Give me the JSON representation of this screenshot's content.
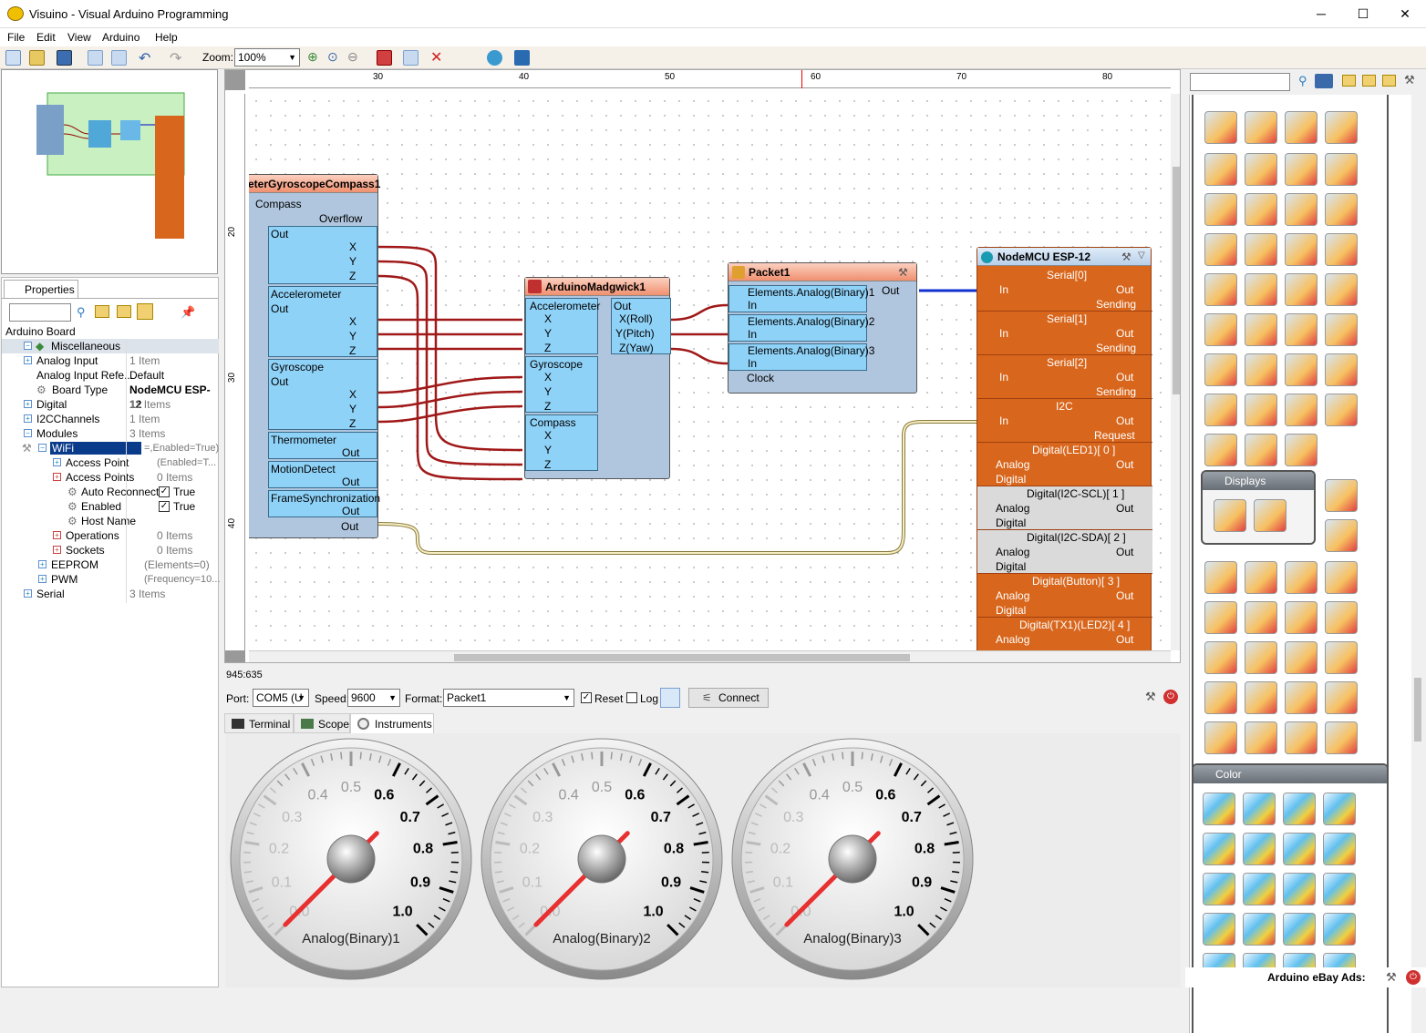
{
  "window": {
    "title": "Visuino - Visual Arduino Programming",
    "controls": {
      "minimize": "─",
      "maximize": "☐",
      "close": "✕"
    }
  },
  "menu": [
    "File",
    "Edit",
    "View",
    "Arduino",
    "Help"
  ],
  "toolbar": {
    "zoom_label": "Zoom:",
    "zoom_value": "100%"
  },
  "properties": {
    "tab_label": "Properties",
    "root": "Arduino Board",
    "rows": [
      {
        "label": "Miscellaneous",
        "value": ""
      },
      {
        "label": "Analog Input",
        "value": "1 Item"
      },
      {
        "label": "Analog Input Refe...",
        "value": "Default"
      },
      {
        "label": "Board Type",
        "value": "NodeMCU ESP-12"
      },
      {
        "label": "Digital",
        "value": "11 Items"
      },
      {
        "label": "I2CChannels",
        "value": "1 Item"
      },
      {
        "label": "Modules",
        "value": "3 Items"
      },
      {
        "label": "WiFi",
        "value": "=,Enabled=True)"
      },
      {
        "label": "Access Point",
        "value": "(Enabled=T..."
      },
      {
        "label": "Access Points",
        "value": "0 Items"
      },
      {
        "label": "Auto Reconnect",
        "value": "True"
      },
      {
        "label": "Enabled",
        "value": "True"
      },
      {
        "label": "Host Name",
        "value": ""
      },
      {
        "label": "Operations",
        "value": "0 Items"
      },
      {
        "label": "Sockets",
        "value": "0 Items"
      },
      {
        "label": "EEPROM",
        "value": "(Elements=0)"
      },
      {
        "label": "PWM",
        "value": "(Frequency=10..."
      },
      {
        "label": "Serial",
        "value": "3 Items"
      }
    ]
  },
  "ruler": {
    "h_ticks": [
      "30",
      "40",
      "50",
      "60",
      "70",
      "80"
    ],
    "v_ticks": [
      "20",
      "30",
      "40"
    ]
  },
  "components": {
    "sensor": {
      "title": "eterGyroscopeCompass1",
      "compass": "Compass",
      "overflow": "Overflow",
      "out": "Out",
      "x": "X",
      "y": "Y",
      "z": "Z",
      "accelerometer": "Accelerometer",
      "gyroscope": "Gyroscope",
      "thermometer": "Thermometer",
      "motion": "MotionDetect",
      "framesync": "FrameSynchronization"
    },
    "madgwick": {
      "title": "ArduinoMadgwick1",
      "accelerometer": "Accelerometer",
      "gyroscope": "Gyroscope",
      "compass": "Compass",
      "out": "Out",
      "roll": "X(Roll)",
      "pitch": "Y(Pitch)",
      "yaw": "Z(Yaw)",
      "x": "X",
      "y": "Y",
      "z": "Z"
    },
    "packet": {
      "title": "Packet1",
      "e1": "Elements.Analog(Binary)1",
      "e2": "Elements.Analog(Binary)2",
      "e3": "Elements.Analog(Binary)3",
      "in": "In",
      "clock": "Clock",
      "out": "Out"
    },
    "node": {
      "title": "NodeMCU ESP-12",
      "serial0": "Serial[0]",
      "serial1": "Serial[1]",
      "serial2": "Serial[2]",
      "i2c": "I2C",
      "in": "In",
      "out": "Out",
      "sending": "Sending",
      "request": "Request",
      "d0": "Digital(LED1)[ 0 ]",
      "d1": "Digital(I2C-SCL)[ 1 ]",
      "d2": "Digital(I2C-SDA)[ 2 ]",
      "d3": "Digital(Button)[ 3 ]",
      "d4": "Digital(TX1)(LED2)[ 4 ]",
      "analog": "Analog",
      "digital": "Digital"
    }
  },
  "status": {
    "coords": "945:635"
  },
  "serial": {
    "port_label": "Port:",
    "port_value": "COM5 (U",
    "speed_label": "Speed:",
    "speed_value": "9600",
    "format_label": "Format:",
    "format_value": "Packet1",
    "reset_label": "Reset",
    "log_label": "Log",
    "connect_label": "Connect"
  },
  "tabs": [
    "Terminal",
    "Scope",
    "Instruments"
  ],
  "gauges": [
    {
      "label": "Analog(Binary)1",
      "value": 0.0
    },
    {
      "label": "Analog(Binary)2",
      "value": 0.0
    },
    {
      "label": "Analog(Binary)3",
      "value": 0.0
    }
  ],
  "gauge_ticks": [
    "0.0",
    "0.1",
    "0.2",
    "0.3",
    "0.4",
    "0.5",
    "0.6",
    "0.7",
    "0.8",
    "0.9",
    "1.0"
  ],
  "palette": {
    "displays_label": "Displays",
    "color_label": "Color"
  },
  "ads": {
    "label": "Arduino eBay Ads:"
  }
}
